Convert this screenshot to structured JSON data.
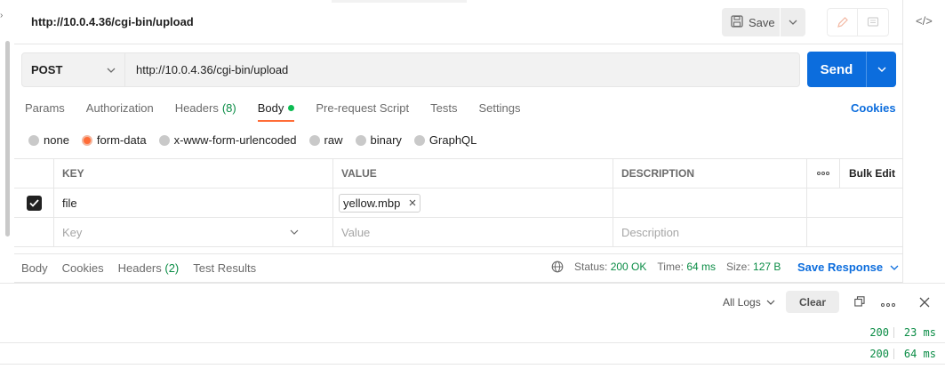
{
  "request": {
    "title": "http://10.0.4.36/cgi-bin/upload",
    "save_label": "Save",
    "method": "POST",
    "url": "http://10.0.4.36/cgi-bin/upload",
    "send_label": "Send"
  },
  "tabs": {
    "params": "Params",
    "authorization": "Authorization",
    "headers": "Headers",
    "headers_count": "(8)",
    "body": "Body",
    "prerequest": "Pre-request Script",
    "tests": "Tests",
    "settings": "Settings",
    "cookies": "Cookies"
  },
  "body_modes": {
    "none": "none",
    "form_data": "form-data",
    "urlencoded": "x-www-form-urlencoded",
    "raw": "raw",
    "binary": "binary",
    "graphql": "GraphQL",
    "selected": "form-data"
  },
  "table": {
    "headers": {
      "key": "KEY",
      "value": "VALUE",
      "description": "DESCRIPTION",
      "bulk_edit": "Bulk Edit"
    },
    "rows": [
      {
        "key": "file",
        "value": "yellow.mbp",
        "description": "",
        "checked": true
      }
    ],
    "placeholders": {
      "key": "Key",
      "value": "Value",
      "description": "Description"
    }
  },
  "response": {
    "tabs": {
      "body": "Body",
      "cookies": "Cookies",
      "headers": "Headers",
      "headers_count": "(2)",
      "test_results": "Test Results"
    },
    "status_label": "Status:",
    "status_value": "200 OK",
    "time_label": "Time:",
    "time_value": "64 ms",
    "size_label": "Size:",
    "size_value": "127 B",
    "save_response": "Save Response"
  },
  "console": {
    "filter": "All Logs",
    "clear": "Clear",
    "logs": [
      {
        "status": "200",
        "time": "23 ms"
      },
      {
        "status": "200",
        "time": "64 ms"
      }
    ]
  },
  "colors": {
    "accent": "#ff6c37",
    "primary": "#0c6ddd",
    "success": "#0a8c45"
  }
}
